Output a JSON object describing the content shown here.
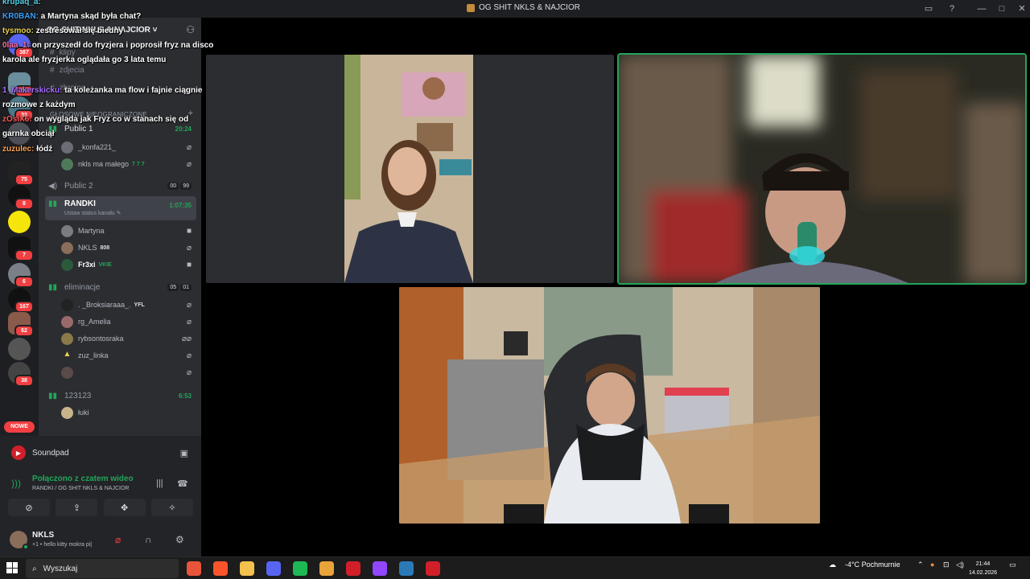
{
  "window": {
    "title": "OG SHIT NKLS & NAJCIOR"
  },
  "server": {
    "name": "OG SHIT NKLS & NAJCIOR ˅"
  },
  "servers": [
    {
      "badge": "387",
      "color": "#5865f2"
    },
    {
      "badge": "23",
      "color": "#6b8e9c"
    },
    {
      "badge": "33",
      "color": "#4a7a8a"
    },
    {
      "badge": "",
      "color": "#4e5058"
    },
    {
      "badge": "75",
      "color": "#222"
    },
    {
      "badge": "8",
      "color": "#111"
    },
    {
      "badge": "",
      "color": "#f5e50a"
    },
    {
      "badge": "7",
      "color": "#111"
    },
    {
      "badge": "6",
      "color": "#7a7f88"
    },
    {
      "badge": "167",
      "color": "#111"
    },
    {
      "badge": "62",
      "color": "#8a5a4a"
    },
    {
      "badge": "",
      "color": "#555"
    },
    {
      "badge": "38",
      "color": "#444"
    }
  ],
  "nowe": "NOWE",
  "text_channels": [
    "klipy",
    "zdjecia",
    "zbrojne"
  ],
  "category": "GŁOSOWE NIEOGRANICZONE",
  "voice_channels": {
    "public1": {
      "name": "Public 1",
      "timer": "20:24"
    },
    "public1_users": [
      {
        "name": "_konfa221_",
        "tag": ""
      },
      {
        "name": "nkls ma małego",
        "tag": "7 7 7"
      }
    ],
    "public2": {
      "name": "Public 2",
      "cap1": "00",
      "cap2": "99"
    },
    "randki": {
      "name": "RANDKI",
      "timer": "1:07:35",
      "status": "Ustaw status kanału ✎"
    },
    "randki_users": [
      {
        "name": "Martyna",
        "tag": ""
      },
      {
        "name": "NKLS",
        "tag": "808"
      },
      {
        "name": "Fr3xi",
        "tag": "VKIE"
      }
    ],
    "eliminacje": {
      "name": "eliminacje",
      "cap1": "05",
      "cap2": "01"
    },
    "elim_users": [
      {
        "name": ". _Broksiaraaa_.",
        "tag": "YFL"
      },
      {
        "name": "rg_Amelia",
        "tag": ""
      },
      {
        "name": "rybsontosraka",
        "tag": ""
      },
      {
        "name": "zuz_linka",
        "tag": ""
      },
      {
        "name": "",
        "tag": ""
      }
    ],
    "ch123": {
      "name": "123123",
      "timer": "6:53"
    },
    "ch123_users": [
      {
        "name": "łuki",
        "tag": ""
      }
    ]
  },
  "soundpad": {
    "label": "Soundpad"
  },
  "connection": {
    "status": "Połączono z czatem wideo",
    "location": "RANDKI / OG SHIT NKLS & NAJCIOR"
  },
  "me": {
    "name": "NKLS",
    "status": "+1 • hello kitty mokra pi|"
  },
  "chat": [
    {
      "user": "krupaq_a:",
      "color": "#4fd1e8",
      "text": ""
    },
    {
      "user": "KR0BAN:",
      "color": "#3aa0ff",
      "text": "a Martyna skąd była chat?"
    },
    {
      "user": "tysmoo:",
      "color": "#e8d24f",
      "text": "zestresował się biedny"
    },
    {
      "user": "0laa_1:",
      "color": "#ff6ea1",
      "text": "on przyszedł do fryzjera i poprosił fryz na disco karola ale fryzjerka oglądała go 3 lata temu"
    },
    {
      "user": "1_Makerskicku:",
      "color": "#a970ff",
      "text": "ta koleżanka ma flow i fajnie ciągnie rozmowe z każdym"
    },
    {
      "user": "zOsiX6:",
      "color": "#ff5a5a",
      "text": "on wygląda jak Fryz co w stanach się od garnka obciął"
    },
    {
      "user": "zuzulec:",
      "color": "#ffa64f",
      "text": "łódź"
    }
  ],
  "taskbar": {
    "search": "Wyszukaj",
    "weather": "-4°C  Pochmurnie",
    "time": "21:44",
    "date": "14.02.2026",
    "apps": [
      "#e8553a",
      "#fb542b",
      "#f2c14e",
      "#5865f2",
      "#1db954",
      "#e8a33a",
      "#d11f2a",
      "#9146ff",
      "#2a7ab8",
      "#d11f2a"
    ]
  }
}
